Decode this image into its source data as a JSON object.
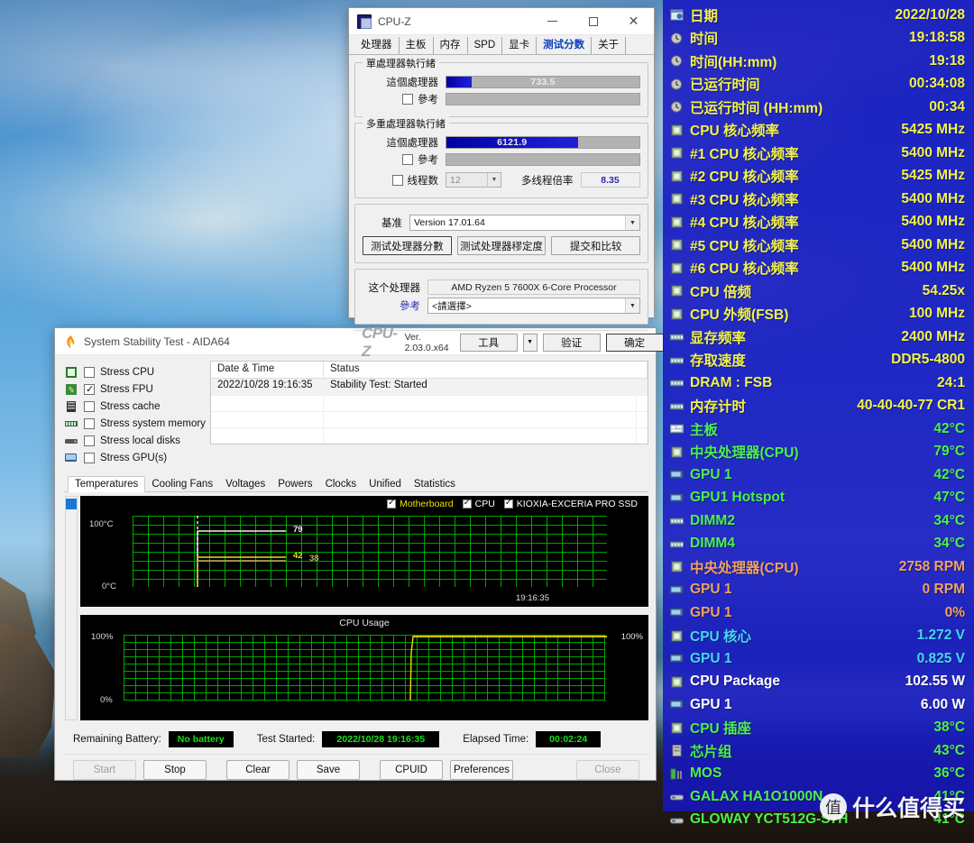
{
  "cpuz": {
    "title": "CPU-Z",
    "icon": "cpu-chip-icon",
    "window_buttons": {
      "minimize": "–",
      "maximize": "☐",
      "close": "✕"
    },
    "tabs": [
      {
        "label": "处理器",
        "active": false
      },
      {
        "label": "主板",
        "active": false
      },
      {
        "label": "内存",
        "active": false
      },
      {
        "label": "SPD",
        "active": false
      },
      {
        "label": "显卡",
        "active": false
      },
      {
        "label": "测试分数",
        "active": true
      },
      {
        "label": "关于",
        "active": false
      }
    ],
    "single_thread": {
      "group_title": "單處理器執行緒",
      "this_cpu_label": "這個處理器",
      "this_cpu_score": "733.5",
      "this_cpu_fill_pct": 13,
      "reference_label": "參考",
      "reference_checked": false,
      "reference_score": ""
    },
    "multi_thread": {
      "group_title": "多重處理器執行緒",
      "this_cpu_label": "這個處理器",
      "this_cpu_score": "6121.9",
      "this_cpu_fill_pct": 68,
      "reference_label": "參考",
      "reference_checked": false,
      "threads_label": "线程数",
      "threads_checked": false,
      "threads_value": "12",
      "ratio_label": "多线程倍率",
      "ratio_value": "8.35"
    },
    "benchmark": {
      "version_label": "基准",
      "version_value": "Version 17.01.64",
      "btn_bench_cpu": "测试处理器分數",
      "btn_stress_cpu": "测试处理器穋定度",
      "btn_submit": "提交和比较"
    },
    "processor": {
      "this_cpu_label": "这个处理器",
      "this_cpu_name": "AMD Ryzen 5 7600X 6-Core Processor",
      "reference_label": "參考",
      "reference_value": "<請選擇>"
    },
    "statusbar": {
      "logo": "CPU-Z",
      "version": "Ver. 2.03.0.x64",
      "tools": "工具",
      "tools_arrow": "▼",
      "validate": "验证",
      "ok": "确定"
    }
  },
  "aida": {
    "title": "System Stability Test - AIDA64",
    "icon": "flame-icon",
    "window_buttons": {
      "minimize": "–",
      "maximize": "☐",
      "close": "✕"
    },
    "stress_options": [
      {
        "label": "Stress CPU",
        "checked": false,
        "icon": "cpu-icon"
      },
      {
        "label": "Stress FPU",
        "checked": true,
        "icon": "fpu-icon"
      },
      {
        "label": "Stress cache",
        "checked": false,
        "icon": "cache-icon"
      },
      {
        "label": "Stress system memory",
        "checked": false,
        "icon": "memory-icon"
      },
      {
        "label": "Stress local disks",
        "checked": false,
        "icon": "disk-icon"
      },
      {
        "label": "Stress GPU(s)",
        "checked": false,
        "icon": "gpu-icon"
      }
    ],
    "log": {
      "columns": [
        "Date & Time",
        "Status"
      ],
      "rows": [
        {
          "datetime": "2022/10/28 19:16:35",
          "status": "Stability Test: Started"
        }
      ],
      "empty_rows": 5
    },
    "tabs": [
      {
        "label": "Temperatures",
        "active": true
      },
      {
        "label": "Cooling Fans",
        "active": false
      },
      {
        "label": "Voltages",
        "active": false
      },
      {
        "label": "Powers",
        "active": false
      },
      {
        "label": "Clocks",
        "active": false
      },
      {
        "label": "Unified",
        "active": false
      },
      {
        "label": "Statistics",
        "active": false
      }
    ],
    "status": {
      "battery_label": "Remaining Battery:",
      "battery_value": "No battery",
      "started_label": "Test Started:",
      "started_value": "2022/10/28 19:16:35",
      "elapsed_label": "Elapsed Time:",
      "elapsed_value": "00:02:24"
    },
    "buttons": {
      "start": "Start",
      "stop": "Stop",
      "clear": "Clear",
      "save": "Save",
      "cpuid": "CPUID",
      "preferences": "Preferences",
      "close": "Close"
    }
  },
  "chart_data": [
    {
      "type": "line",
      "title": "",
      "ylabel": "",
      "ytick_top": "100°C",
      "ytick_bottom": "0°C",
      "ylim": [
        0,
        100
      ],
      "xlabel": "",
      "xtick": "19:16:35",
      "grid": true,
      "legend_position": "top-right",
      "series": [
        {
          "name": "Motherboard",
          "color": "#e8e000",
          "current": 42,
          "label": "42"
        },
        {
          "name": "CPU",
          "color": "#ffffff",
          "current": 79,
          "label": "79"
        },
        {
          "name": "KIOXIA-EXCERIA PRO SSD",
          "color": "#c8a860",
          "current": 38,
          "label": "38"
        }
      ]
    },
    {
      "type": "line",
      "title": "CPU Usage",
      "ytick_top": "100%",
      "ytick_bottom": "0%",
      "ylim": [
        0,
        100
      ],
      "grid": true,
      "right_label": "100%",
      "series": [
        {
          "name": "CPU Usage",
          "color": "#e8e000",
          "current": 100
        }
      ]
    }
  ],
  "osd": {
    "rows": [
      {
        "icon": "calendar-icon",
        "name": "日期",
        "value": "2022/10/28",
        "color": "#f2f24a"
      },
      {
        "icon": "clock-icon",
        "name": "时间",
        "value": "19:18:58",
        "color": "#f2f24a"
      },
      {
        "icon": "clock-icon",
        "name": "时间(HH:mm)",
        "value": "19:18",
        "color": "#f2f24a"
      },
      {
        "icon": "clock-icon",
        "name": "已运行时间",
        "value": "00:34:08",
        "color": "#f2f24a"
      },
      {
        "icon": "clock-icon",
        "name": "已运行时间 (HH:mm)",
        "value": "00:34",
        "color": "#f2f24a"
      },
      {
        "icon": "cpu-icon",
        "name": "CPU 核心频率",
        "value": "5425 MHz",
        "color": "#f2f24a"
      },
      {
        "icon": "cpu-icon",
        "name": "#1 CPU 核心频率",
        "value": "5400 MHz",
        "color": "#f2f24a"
      },
      {
        "icon": "cpu-icon",
        "name": "#2 CPU 核心频率",
        "value": "5425 MHz",
        "color": "#f2f24a"
      },
      {
        "icon": "cpu-icon",
        "name": "#3 CPU 核心频率",
        "value": "5400 MHz",
        "color": "#f2f24a"
      },
      {
        "icon": "cpu-icon",
        "name": "#4 CPU 核心频率",
        "value": "5400 MHz",
        "color": "#f2f24a"
      },
      {
        "icon": "cpu-icon",
        "name": "#5 CPU 核心频率",
        "value": "5400 MHz",
        "color": "#f2f24a"
      },
      {
        "icon": "cpu-icon",
        "name": "#6 CPU 核心频率",
        "value": "5400 MHz",
        "color": "#f2f24a"
      },
      {
        "icon": "cpu-icon",
        "name": "CPU 倍频",
        "value": "54.25x",
        "color": "#f2f24a"
      },
      {
        "icon": "cpu-icon",
        "name": "CPU 外频(FSB)",
        "value": "100 MHz",
        "color": "#f2f24a"
      },
      {
        "icon": "memory-icon",
        "name": "显存频率",
        "value": "2400 MHz",
        "color": "#f2f24a"
      },
      {
        "icon": "memory-icon",
        "name": "存取速度",
        "value": "DDR5-4800",
        "color": "#f2f24a"
      },
      {
        "icon": "memory-icon",
        "name": "DRAM : FSB",
        "value": "24:1",
        "color": "#f2f24a"
      },
      {
        "icon": "memory-icon",
        "name": "内存计时",
        "value": "40-40-40-77 CR1",
        "color": "#f2f24a"
      },
      {
        "icon": "motherboard-icon",
        "name": "主板",
        "value": "42°C",
        "color": "#4cf04c"
      },
      {
        "icon": "cpu-icon",
        "name": "中央处理器(CPU)",
        "value": "79°C",
        "color": "#4cf04c"
      },
      {
        "icon": "gpu-icon",
        "name": "GPU 1",
        "value": "42°C",
        "color": "#4cf04c"
      },
      {
        "icon": "gpu-icon",
        "name": "GPU1 Hotspot",
        "value": "47°C",
        "color": "#4cf04c"
      },
      {
        "icon": "memory-icon",
        "name": "DIMM2",
        "value": "34°C",
        "color": "#4cf04c"
      },
      {
        "icon": "memory-icon",
        "name": "DIMM4",
        "value": "34°C",
        "color": "#4cf04c"
      },
      {
        "icon": "cpu-icon",
        "name": "中央处理器(CPU)",
        "value": "2758 RPM",
        "color": "#f0a060"
      },
      {
        "icon": "gpu-icon",
        "name": "GPU 1",
        "value": "0 RPM",
        "color": "#f0a060"
      },
      {
        "icon": "gpu-icon",
        "name": "GPU 1",
        "value": "0%",
        "color": "#f0a060"
      },
      {
        "icon": "cpu-icon",
        "name": "CPU 核心",
        "value": "1.272 V",
        "color": "#44d8f0"
      },
      {
        "icon": "gpu-icon",
        "name": "GPU 1",
        "value": "0.825 V",
        "color": "#44d8f0"
      },
      {
        "icon": "cpu-icon",
        "name": "CPU Package",
        "value": "102.55 W",
        "color": "#ffffff"
      },
      {
        "icon": "gpu-icon",
        "name": "GPU 1",
        "value": "6.00 W",
        "color": "#ffffff"
      },
      {
        "icon": "cpu-icon",
        "name": "CPU 插座",
        "value": "38°C",
        "color": "#4cf04c"
      },
      {
        "icon": "chipset-icon",
        "name": "芯片组",
        "value": "43°C",
        "color": "#4cf04c"
      },
      {
        "icon": "mos-icon",
        "name": "MOS",
        "value": "36°C",
        "color": "#4cf04c"
      },
      {
        "icon": "drive-icon",
        "name": "GALAX HA1O1000N",
        "value": "41°C",
        "color": "#4cf04c"
      },
      {
        "icon": "drive-icon",
        "name": "GLOWAY YCT512G-S7H",
        "value": "41°C",
        "color": "#4cf04c"
      }
    ]
  },
  "watermark": {
    "symbol": "值",
    "text": "什么值得买"
  }
}
